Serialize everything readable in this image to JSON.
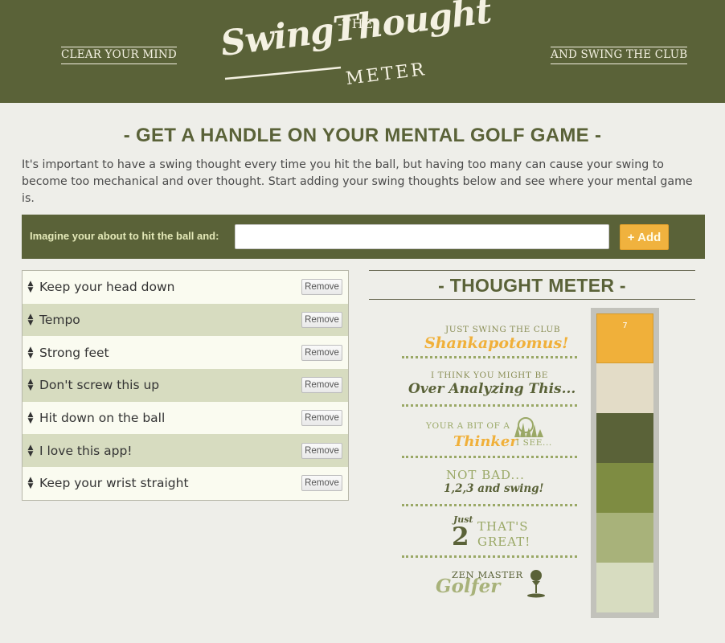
{
  "header": {
    "left_link": "CLEAR YOUR MIND",
    "right_link": "AND SWING THE CLUB",
    "logo": {
      "the": "-THE-",
      "title": "SwingThought",
      "meter": "METER"
    },
    "bg_color": "#5a6238"
  },
  "intro": {
    "headline": "- GET A HANDLE ON YOUR MENTAL GOLF GAME -",
    "body": "It's important to have a swing thought every time you hit the ball, but having too many can cause your swing to become too mechanical and over thought. Start adding your swing thoughts below and see where your mental game is."
  },
  "add_form": {
    "label": "Imagine your about to hit the ball and:",
    "input_value": "",
    "button_label": "+ Add"
  },
  "thoughts": [
    {
      "text": "Keep your head down",
      "remove_label": "Remove"
    },
    {
      "text": "Tempo",
      "remove_label": "Remove"
    },
    {
      "text": "Strong feet",
      "remove_label": "Remove"
    },
    {
      "text": "Don't screw this up",
      "remove_label": "Remove"
    },
    {
      "text": "Hit down on the ball",
      "remove_label": "Remove"
    },
    {
      "text": "I love this app!",
      "remove_label": "Remove"
    },
    {
      "text": "Keep your wrist straight",
      "remove_label": "Remove"
    }
  ],
  "meter": {
    "title": "- THOUGHT METER -",
    "count": "7",
    "levels": [
      {
        "small": "JUST SWING THE CLUB",
        "big": "Shankapotomus!",
        "color": "#f0b03a"
      },
      {
        "small": "I THINK YOU MIGHT BE",
        "big": "Over Analyzing This...",
        "color": "#e3dcc7"
      },
      {
        "small": "YOUR A BIT OF A",
        "big": "Thinker",
        "small2": "I SEE...",
        "color": "#5a6238"
      },
      {
        "small": "NOT BAD...",
        "big": "1,2,3 and swing!",
        "color": "#7e8c42"
      },
      {
        "small": "Just",
        "big": "2",
        "small2": "THAT'S GREAT!",
        "color": "#a8b27a"
      },
      {
        "small": "ZEN MASTER",
        "big": "Golfer",
        "color": "#d7dcc0"
      }
    ]
  },
  "icons": {
    "drag": "drag-handle-icon",
    "grass": "grass-ball-icon",
    "tee": "golf-tee-icon"
  }
}
